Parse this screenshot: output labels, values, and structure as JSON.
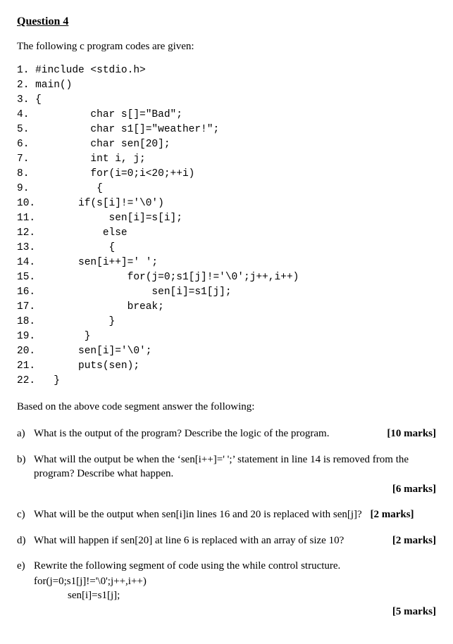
{
  "title": "Question 4",
  "intro": "The following c program codes are given:",
  "code": "1. #include <stdio.h>\n2. main()\n3. {\n4.          char s[]=\"Bad\";\n5.          char s1[]=\"weather!\";\n6.          char sen[20];\n7.          int i, j;\n8.          for(i=0;i<20;++i)\n9.           {\n10.       if(s[i]!='\\0')\n11.            sen[i]=s[i];\n12.           else\n13.            {\n14.       sen[i++]=' ';\n15.               for(j=0;s1[j]!='\\0';j++,i++)\n16.                   sen[i]=s1[j];\n17.               break;\n18.            }\n19.        }\n20.       sen[i]='\\0';\n21.       puts(sen);\n22.   }",
  "based": "Based on the above code segment answer the following:",
  "parts": {
    "a": {
      "letter": "a)",
      "text": "What is the output of the program? Describe the logic of the program.",
      "marks": "[10 marks]"
    },
    "b": {
      "letter": "b)",
      "text": "What will the output be when the ‘sen[i++]=' ';’ statement in line 14 is removed from the program?  Describe what happen.",
      "marks": "[6 marks]"
    },
    "c": {
      "letter": "c)",
      "text": "What will be the output when sen[i]in lines 16 and 20 is replaced with sen[j]?",
      "marks": "[2 marks]"
    },
    "d": {
      "letter": "d)",
      "text": "What will happen if sen[20] at line 6 is replaced with an array of size 10?",
      "marks": "[2 marks]"
    },
    "e": {
      "letter": "e)",
      "text": "Rewrite the following segment of code using the while control structure.",
      "sub1": "for(j=0;s1[j]!='\\0';j++,i++)",
      "sub2": "sen[i]=s1[j];",
      "marks": "[5 marks]"
    }
  }
}
